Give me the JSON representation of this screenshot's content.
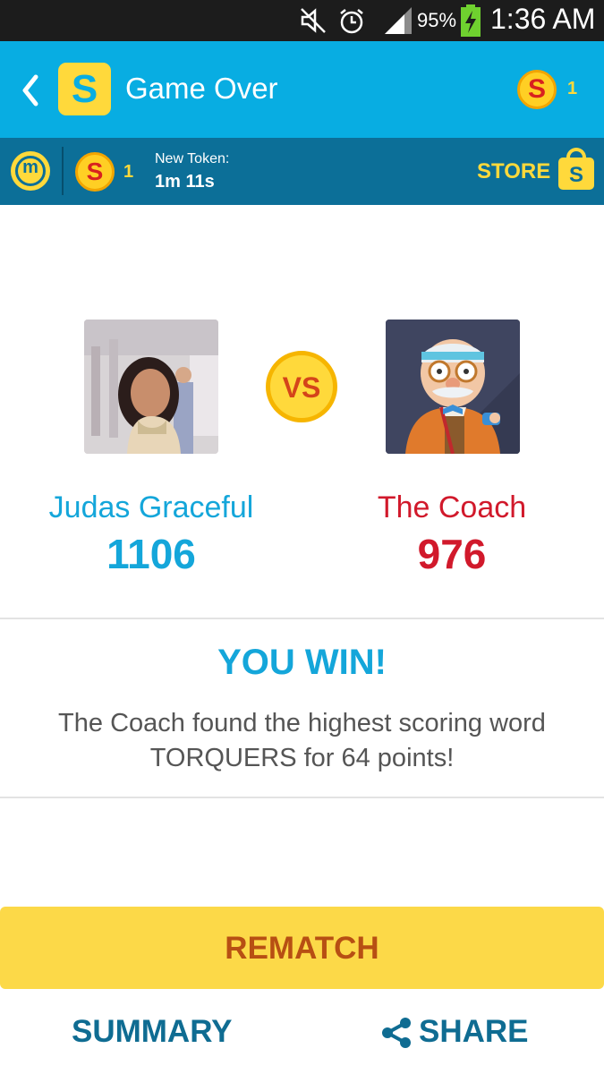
{
  "status_bar": {
    "battery": "95%",
    "time": "1:36 AM",
    "icons": [
      "mute-icon",
      "alarm-icon",
      "signal-icon",
      "battery-charging-icon"
    ]
  },
  "app_bar": {
    "title": "Game Over",
    "logo_letter": "S",
    "coin_symbol": "S",
    "coin_count": "1"
  },
  "sub_bar": {
    "m_badge": "m",
    "coin_symbol": "S",
    "coin_count": "1",
    "token_label": "New Token:",
    "token_time": "1m 11s",
    "store_label": "STORE",
    "store_bag_letter": "S"
  },
  "match": {
    "vs_label": "VS",
    "player1": {
      "name": "Judas Graceful",
      "score": "1106"
    },
    "player2": {
      "name": "The Coach",
      "score": "976"
    }
  },
  "result": {
    "title": "YOU WIN!",
    "detail": "The Coach found the highest scoring word TORQUERS for 64 points!"
  },
  "actions": {
    "rematch": "REMATCH",
    "summary": "SUMMARY",
    "share": "SHARE"
  },
  "colors": {
    "app_bar": "#08ade2",
    "sub_bar": "#0c6f98",
    "accent_yellow": "#ffd93b",
    "player1": "#14a6da",
    "player2": "#d1192b",
    "rematch_bg": "#fcd948",
    "rematch_text": "#b74f13"
  }
}
